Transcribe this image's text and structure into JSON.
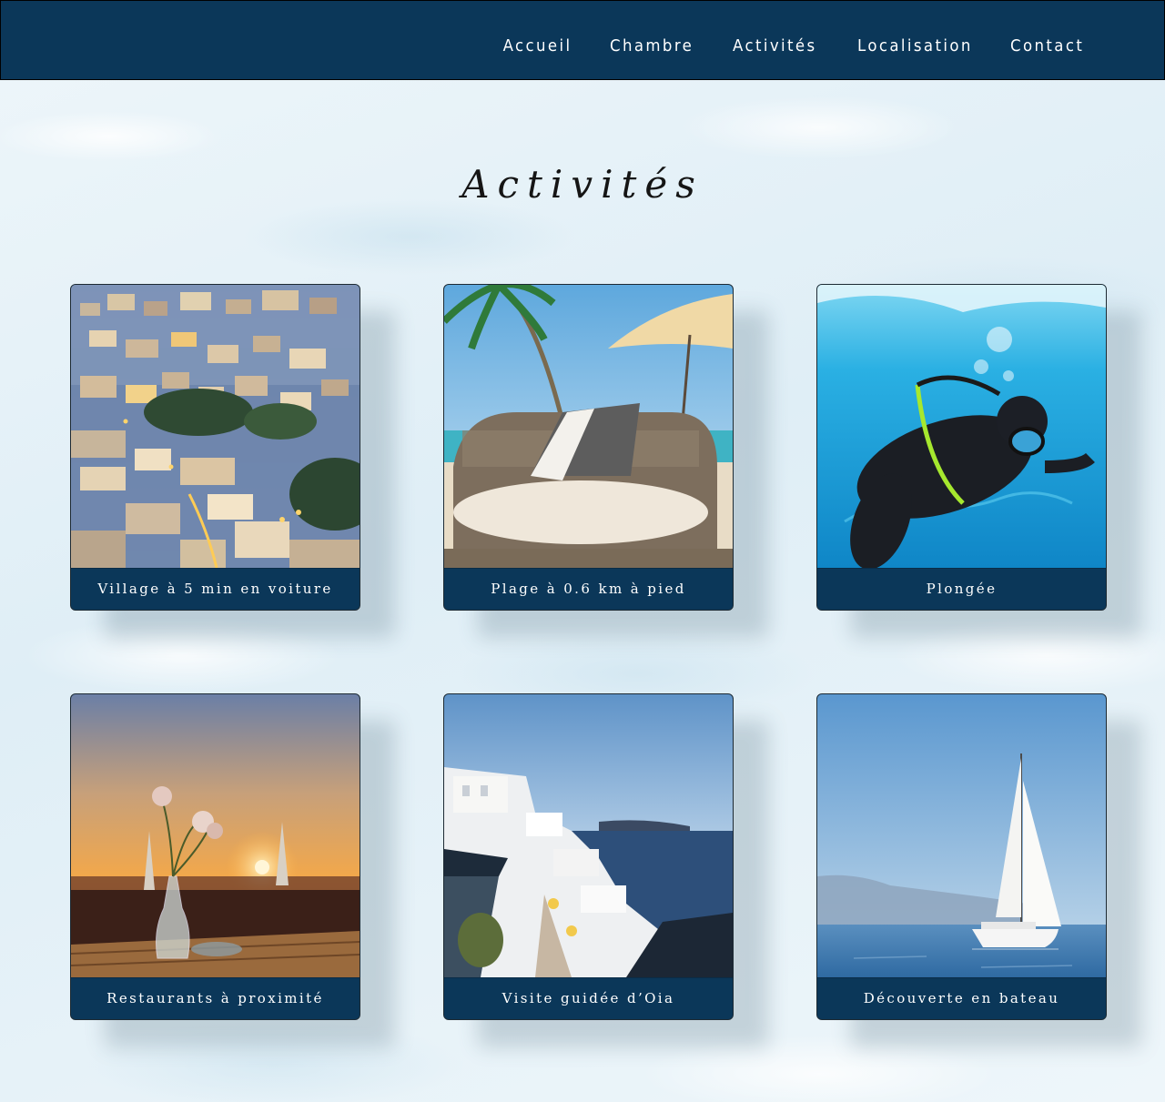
{
  "nav": {
    "items": [
      {
        "label": "Accueil"
      },
      {
        "label": "Chambre"
      },
      {
        "label": "Activités"
      },
      {
        "label": "Localisation"
      },
      {
        "label": "Contact"
      }
    ]
  },
  "page": {
    "title": "Activités"
  },
  "activities": [
    {
      "caption": "Village à 5 min en voiture",
      "image": "hillside-town-photo"
    },
    {
      "caption": "Plage à 0.6 km à pied",
      "image": "beach-lounge-photo"
    },
    {
      "caption": "Plongée",
      "image": "scuba-diver-photo"
    },
    {
      "caption": "Restaurants à proximité",
      "image": "sunset-terrace-photo"
    },
    {
      "caption": "Visite guidée d’Oia",
      "image": "oia-village-photo"
    },
    {
      "caption": "Découverte en bateau",
      "image": "sailboat-photo"
    }
  ],
  "colors": {
    "header_bg": "#0b3759",
    "caption_bg": "#0b3759",
    "text_light": "#ffffff",
    "title_text": "#151515"
  }
}
